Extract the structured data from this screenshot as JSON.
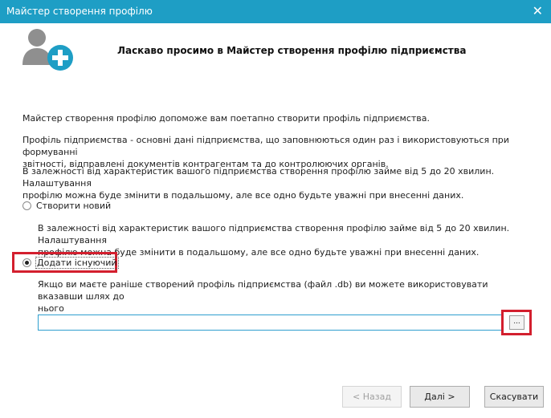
{
  "window": {
    "title": "Майстер створення профілю",
    "close_glyph": "✕"
  },
  "header": {
    "title": "Ласкаво просимо в Майстер створення профілю підприємства",
    "icon": "user-add-icon",
    "accent": "#1e9ec5"
  },
  "intro": {
    "p1": "Майстер створення профілю допоможе вам поетапно створити профіль підприємства.",
    "p2a": "Профіль підприємства - основні дані підприємства, що заповнюються один раз і використовуються при формуванні",
    "p2b": "звітності, відправлені документів контрагентам та до контролюючих органів.",
    "p3a": "В залежності від характеристик вашого підприємства створення профілю займе  від 5 до 20 хвилин. Налаштування",
    "p3b": "профілю можна буде змінити в подальшому, але все одно будьте уважні при внесенні даних."
  },
  "options": {
    "create_new": {
      "label": "Створити новий",
      "checked": false,
      "desc_a": "В залежності від характеристик вашого підприємства створення профілю займе  від 5 до 20 хвилин. Налаштування",
      "desc_b": "профілю можна буде змінити в подальшому, але все одно будьте уважні при внесенні даних."
    },
    "add_existing": {
      "label": "Додати існуючий",
      "checked": true,
      "desc_a": "Якщо ви маєте раніше створений профіль підприємства (файл .db) ви можете використовувати вказавши шлях до",
      "desc_b": "нього"
    }
  },
  "path": {
    "value": "",
    "placeholder": "",
    "browse_label": "..."
  },
  "buttons": {
    "back": "< Назад",
    "next": "Далі >",
    "cancel": "Скасувати"
  },
  "highlight_color": "#d31f2e"
}
